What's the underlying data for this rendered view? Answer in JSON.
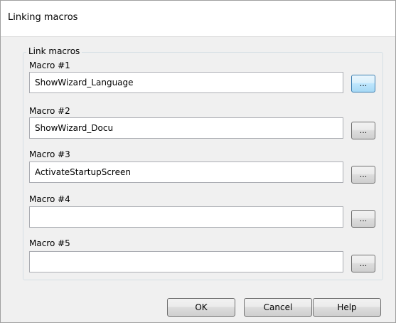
{
  "window": {
    "title": "Linking macros"
  },
  "group": {
    "label": "Link macros"
  },
  "macros": [
    {
      "label": "Macro #1",
      "value": "ShowWizard_Language",
      "browse_label": "..."
    },
    {
      "label": "Macro #2",
      "value": "ShowWizard_Docu",
      "browse_label": "..."
    },
    {
      "label": "Macro #3",
      "value": "ActivateStartupScreen",
      "browse_label": "..."
    },
    {
      "label": "Macro #4",
      "value": "",
      "browse_label": "..."
    },
    {
      "label": "Macro #5",
      "value": "",
      "browse_label": "..."
    }
  ],
  "buttons": {
    "ok": "OK",
    "cancel": "Cancel",
    "help": "Help"
  }
}
